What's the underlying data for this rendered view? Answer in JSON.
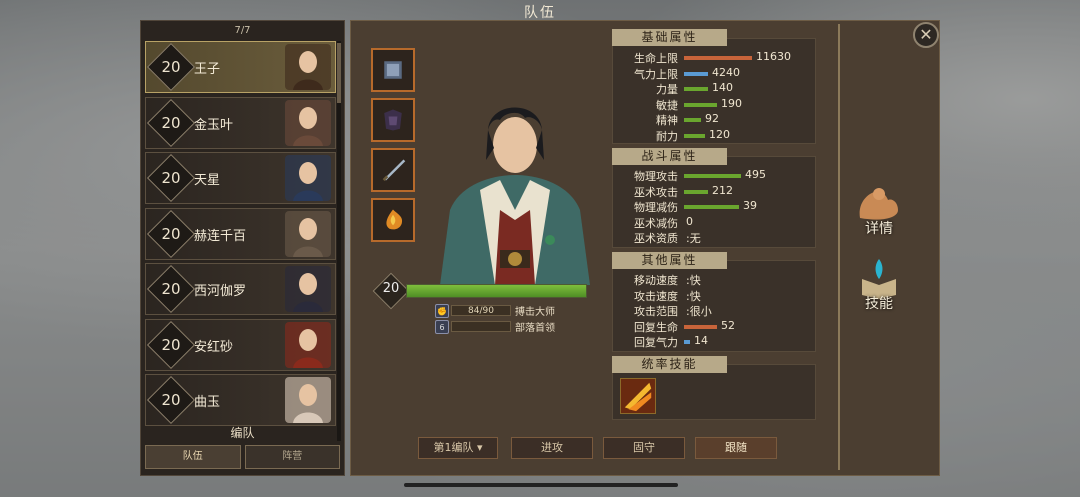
{
  "title": "队伍",
  "roster": {
    "count": "7/7",
    "heroes": [
      {
        "level": "20",
        "name": "王子",
        "selected": true
      },
      {
        "level": "20",
        "name": "金玉叶"
      },
      {
        "level": "20",
        "name": "天星"
      },
      {
        "level": "20",
        "name": "赫连千百"
      },
      {
        "level": "20",
        "name": "西河伽罗"
      },
      {
        "level": "20",
        "name": "安红砂"
      },
      {
        "level": "20",
        "name": "曲玉"
      }
    ],
    "formation_label": "编队",
    "tabs": [
      "队伍",
      "阵营"
    ]
  },
  "hero": {
    "level": "20",
    "exp_fill": 1.0,
    "skill_progress": "84/90",
    "skill_badge": "",
    "skill_name": "搏击大师",
    "rank_badge": "6",
    "rank_name": "部落首领"
  },
  "basic": {
    "header": "基础属性",
    "rows": [
      {
        "label": "生命上限",
        "value": "11630",
        "bar": 0.62,
        "color": "#c8643a"
      },
      {
        "label": "气力上限",
        "value": "4240",
        "bar": 0.22,
        "color": "#5a9bd4"
      },
      {
        "label": "力量",
        "value": "140",
        "bar": 0.22,
        "color": "#6aa62e"
      },
      {
        "label": "敏捷",
        "value": "190",
        "bar": 0.3,
        "color": "#6aa62e"
      },
      {
        "label": "精神",
        "value": "92",
        "bar": 0.15,
        "color": "#6aa62e"
      },
      {
        "label": "耐力",
        "value": "120",
        "bar": 0.19,
        "color": "#6aa62e"
      }
    ]
  },
  "combat": {
    "header": "战斗属性",
    "rows": [
      {
        "label": "物理攻击",
        "value": "495",
        "bar": 0.52,
        "color": "#6aa62e"
      },
      {
        "label": "巫术攻击",
        "value": "212",
        "bar": 0.22,
        "color": "#6aa62e"
      },
      {
        "label": "物理减伤",
        "value": "39",
        "bar": 0.5,
        "color": "#6aa62e"
      },
      {
        "label": "巫术减伤",
        "value": "0",
        "bar": 0,
        "color": "#6aa62e"
      },
      {
        "label": "巫术资质",
        "value": ":无",
        "bar": 0,
        "color": "#6aa62e"
      }
    ]
  },
  "other": {
    "header": "其他属性",
    "rows": [
      {
        "label": "移动速度",
        "value": ":快",
        "bar": 0,
        "color": "#6aa62e"
      },
      {
        "label": "攻击速度",
        "value": ":快",
        "bar": 0,
        "color": "#6aa62e"
      },
      {
        "label": "攻击范围",
        "value": ":很小",
        "bar": 0,
        "color": "#6aa62e"
      },
      {
        "label": "回复生命",
        "value": "52",
        "bar": 0.3,
        "color": "#c8643a"
      },
      {
        "label": "回复气力",
        "value": "14",
        "bar": 0.05,
        "color": "#5a9bd4"
      }
    ]
  },
  "command": {
    "header": "统率技能"
  },
  "side": {
    "details": "详情",
    "skills": "技能"
  },
  "bottom": {
    "team_select": "第1编队",
    "attack": "进攻",
    "defend": "固守",
    "follow": "跟随"
  }
}
